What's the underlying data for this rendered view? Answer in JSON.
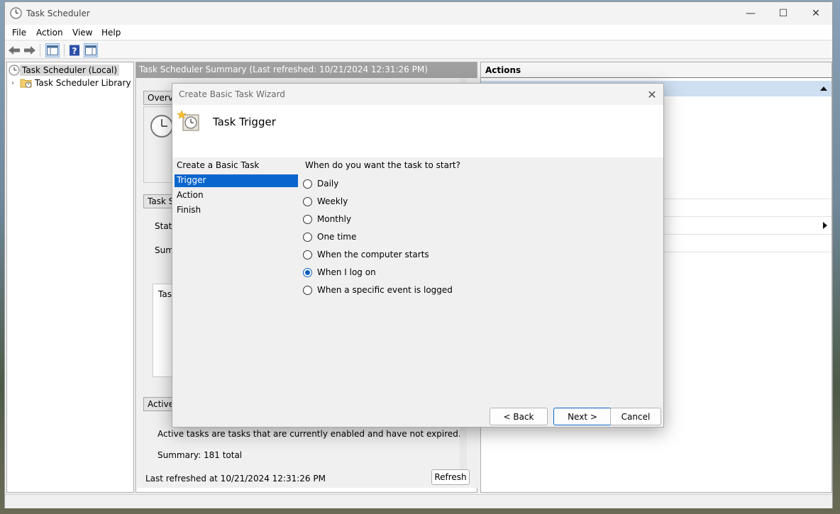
{
  "window": {
    "title": "Task Scheduler",
    "controls": {
      "minimize": "—",
      "maximize": "☐",
      "close": "✕"
    }
  },
  "menu": [
    "File",
    "Action",
    "View",
    "Help"
  ],
  "tree": {
    "root": "Task Scheduler (Local)",
    "child": "Task Scheduler Library"
  },
  "center": {
    "header": "Task Scheduler Summary (Last refreshed: 10/21/2024 12:31:26 PM)",
    "sections": {
      "overview": "Overvi",
      "task_status": "Task S",
      "status_label": "Statu",
      "summary_label": "Sum",
      "tasks_col": "Task",
      "active": "Active"
    },
    "active_desc": "Active tasks are tasks that are currently enabled and have not expired.",
    "active_summary": "Summary: 181 total",
    "last_refreshed": "Last refreshed at 10/21/2024 12:31:26 PM",
    "refresh_label": "Refresh"
  },
  "actions_pane": {
    "title": "Actions"
  },
  "dialog": {
    "title": "Create Basic Task Wizard",
    "close": "✕",
    "heading": "Task Trigger",
    "steps": [
      "Create a Basic Task",
      "Trigger",
      "Action",
      "Finish"
    ],
    "active_step": "Trigger",
    "question": "When do you want the task to start?",
    "options": [
      {
        "label": "Daily",
        "selected": false
      },
      {
        "label": "Weekly",
        "selected": false
      },
      {
        "label": "Monthly",
        "selected": false
      },
      {
        "label": "One time",
        "selected": false
      },
      {
        "label": "When the computer starts",
        "selected": false
      },
      {
        "label": "When I log on",
        "selected": true
      },
      {
        "label": "When a specific event is logged",
        "selected": false
      }
    ],
    "buttons": {
      "back": "< Back",
      "next": "Next >",
      "cancel": "Cancel"
    }
  },
  "colors": {
    "selection_blue": "#0a66cc",
    "radio_blue": "#0a5fbf",
    "center_header": "#a0a0a0",
    "actions_highlight": "#cddff1"
  }
}
